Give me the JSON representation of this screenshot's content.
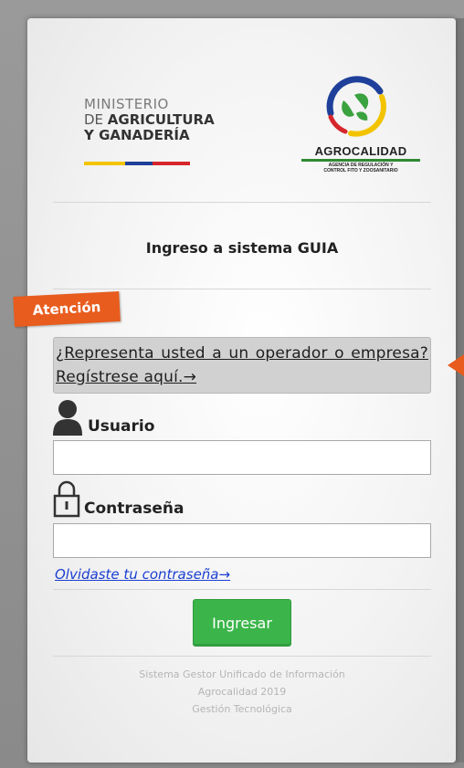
{
  "ministry_logo": {
    "line1": "MINISTERIO",
    "line2_prefix": "DE ",
    "line2_bold": "AGRICULTURA",
    "line3": "Y GANADERÍA",
    "flag_colors": [
      "#f3c300",
      "#1e3f9a",
      "#d6262b"
    ]
  },
  "agro_logo": {
    "name": "AGROCALIDAD",
    "subtitle_1": "AGENCIA DE REGULACIÓN Y",
    "subtitle_2": "CONTROL FITO Y ZOOSANITARIO"
  },
  "login": {
    "title": "Ingreso a sistema GUIA",
    "attention_badge": "Atención",
    "register_link": "¿Representa usted a un operador o empresa? Regístrese aquí.→",
    "username_label": "Usuario",
    "username_value": "",
    "password_label": "Contraseña",
    "password_value": "",
    "forgot_link": "Olvidaste tu contraseña→",
    "submit_label": "Ingresar"
  },
  "footer": {
    "line1": "Sistema Gestor Unificado de Información",
    "line2": "Agrocalidad 2019",
    "line3": "Gestión Tecnológica"
  },
  "colors": {
    "accent_orange": "#e85c1d",
    "button_green": "#3bb54a",
    "link_blue": "#1a3fd1"
  },
  "icons": [
    "user-icon",
    "lock-icon",
    "arrow-pointer-icon"
  ]
}
